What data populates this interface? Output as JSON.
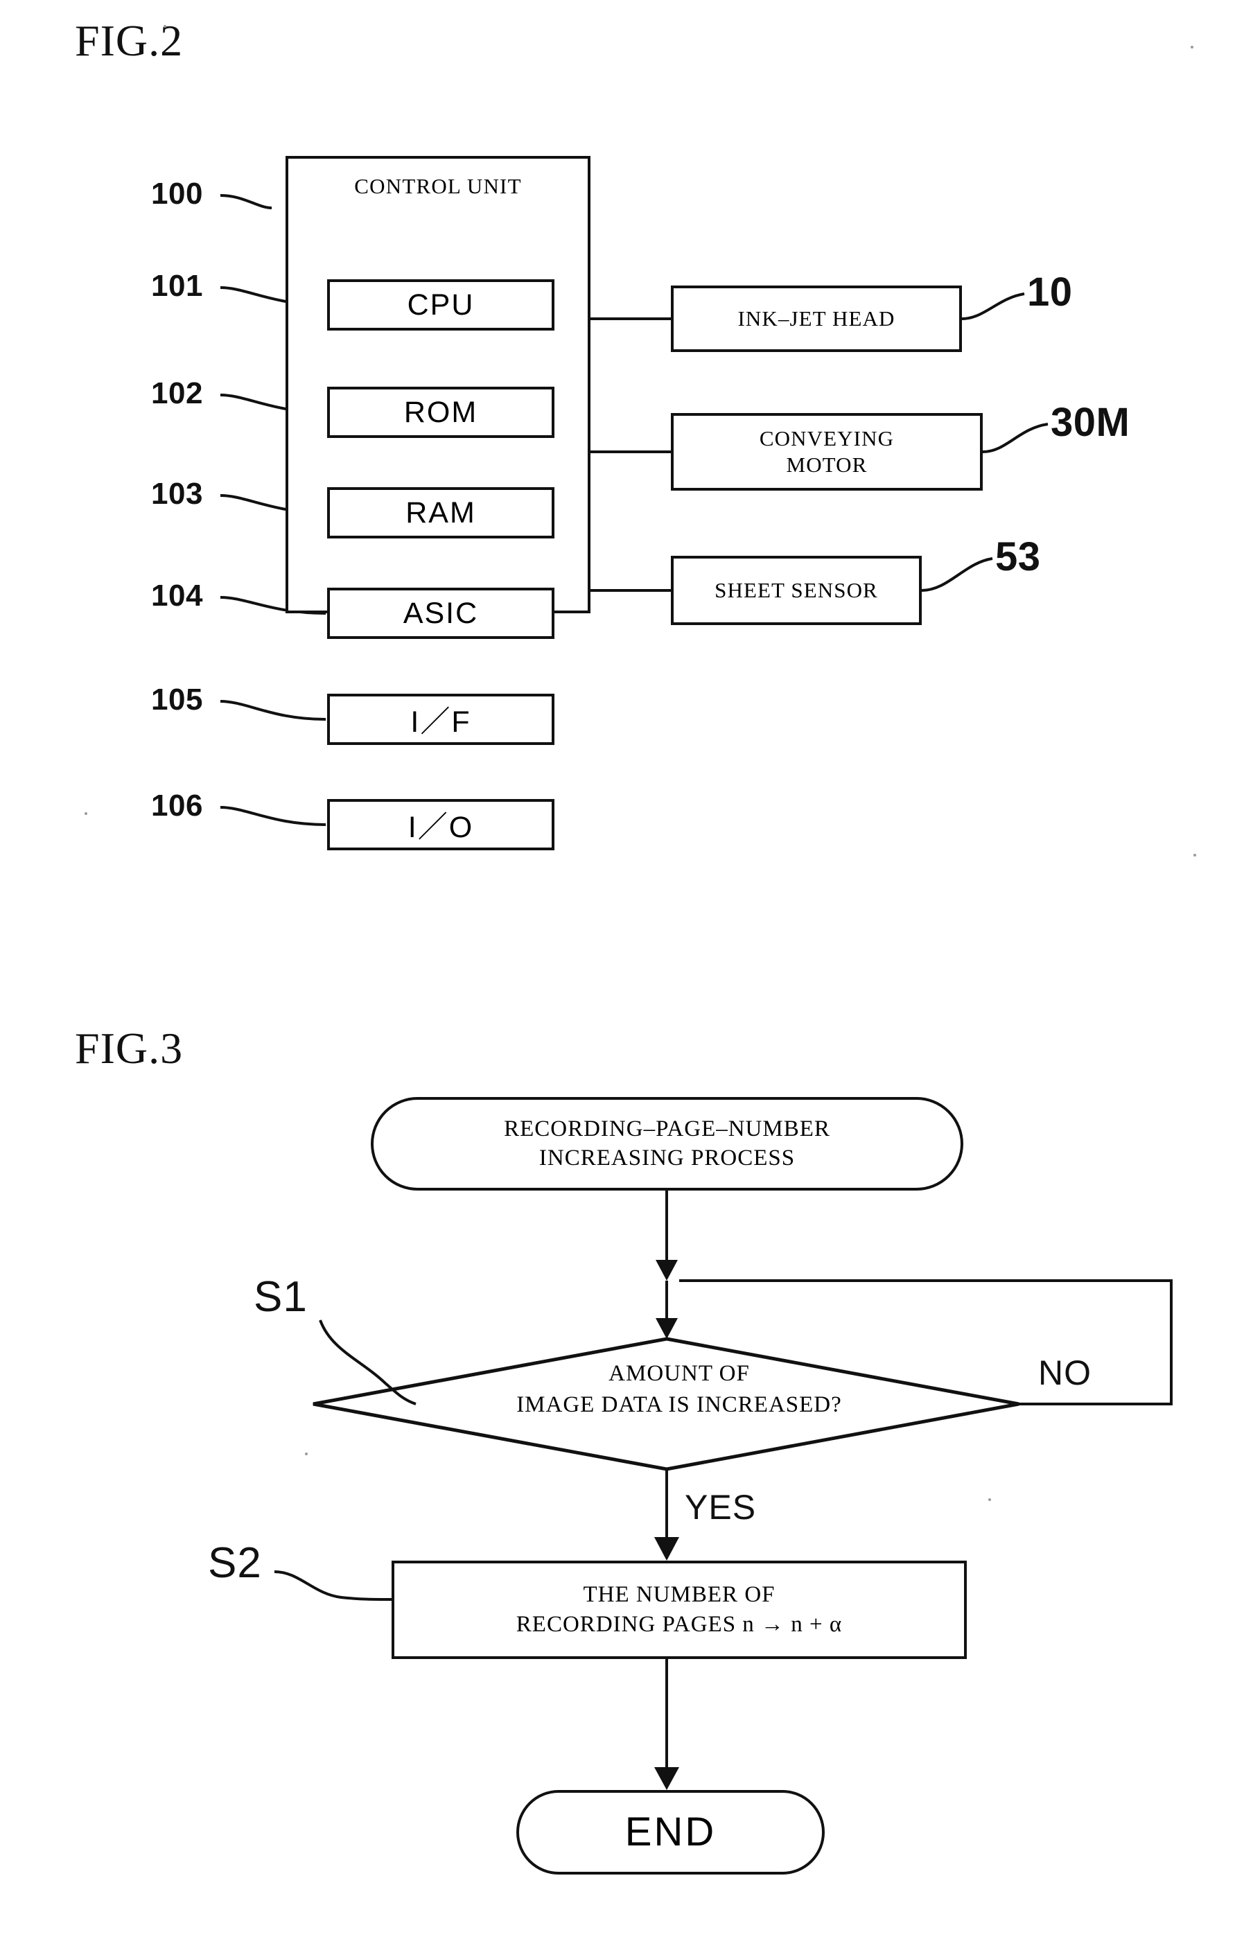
{
  "figures": {
    "fig2": {
      "title": "FIG.2",
      "control_unit": {
        "label": "CONTROL UNIT",
        "ref": "100",
        "components": [
          {
            "ref": "101",
            "label": "CPU"
          },
          {
            "ref": "102",
            "label": "ROM"
          },
          {
            "ref": "103",
            "label": "RAM"
          },
          {
            "ref": "104",
            "label": "ASIC"
          },
          {
            "ref": "105",
            "label": "I／F"
          },
          {
            "ref": "106",
            "label": "I／O"
          }
        ]
      },
      "peripherals": [
        {
          "ref": "10",
          "label": "INK–JET HEAD",
          "label_line2": ""
        },
        {
          "ref": "30M",
          "label": "CONVEYING",
          "label_line2": "MOTOR"
        },
        {
          "ref": "53",
          "label": "SHEET SENSOR",
          "label_line2": ""
        }
      ]
    },
    "fig3": {
      "title": "FIG.3",
      "start": {
        "line1": "RECORDING–PAGE–NUMBER",
        "line2": "INCREASING PROCESS"
      },
      "decision": {
        "step": "S1",
        "line1": "AMOUNT OF",
        "line2": "IMAGE DATA IS INCREASED?",
        "branch_yes": "YES",
        "branch_no": "NO"
      },
      "process": {
        "step": "S2",
        "line1": "THE NUMBER OF",
        "line2": "RECORDING PAGES n → n + α"
      },
      "end": {
        "label": "END"
      }
    }
  },
  "style": {
    "ink": "#111111",
    "paper": "#ffffff"
  }
}
